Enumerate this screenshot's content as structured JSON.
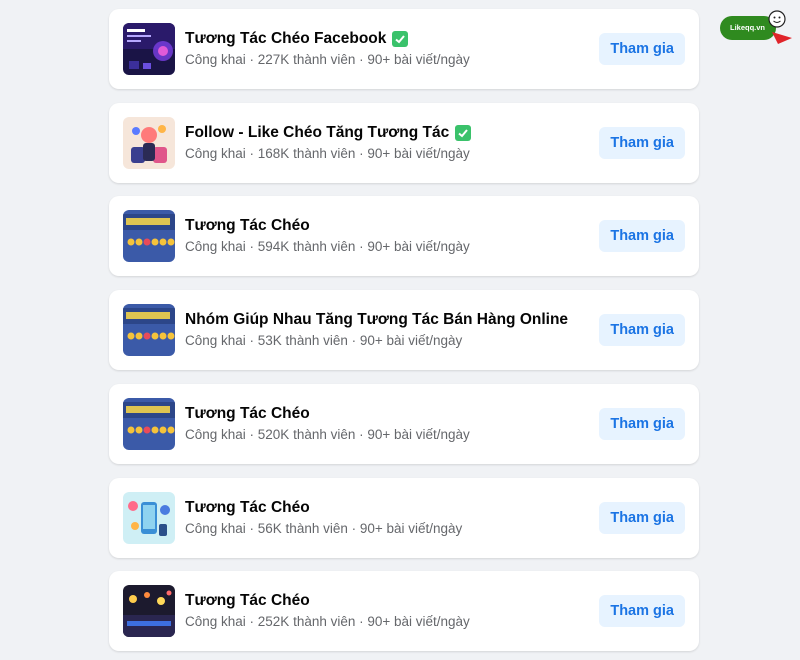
{
  "watermark": {
    "brand": "Likeqq.vn"
  },
  "groups": [
    {
      "name": "Tương Tác Chéo Facebook",
      "verified": true,
      "meta": "Công khai · 227K thành viên · 90+ bài viết/ngày",
      "button": "Tham gia",
      "thumb_icon": "purple-tech-thumbnail"
    },
    {
      "name": "Follow - Like Chéo Tăng Tương Tác",
      "verified": true,
      "meta": "Công khai · 168K thành viên · 90+ bài viết/ngày",
      "button": "Tham gia",
      "thumb_icon": "social-people-thumbnail"
    },
    {
      "name": "Tương Tác Chéo",
      "verified": false,
      "meta": "Công khai · 594K thành viên · 90+ bài viết/ngày",
      "button": "Tham gia",
      "thumb_icon": "reactions-banner-thumbnail"
    },
    {
      "name": "Nhóm Giúp Nhau Tăng Tương Tác Bán Hàng Online",
      "verified": false,
      "meta": "Công khai · 53K thành viên · 90+ bài viết/ngày",
      "button": "Tham gia",
      "thumb_icon": "reactions-banner-thumbnail"
    },
    {
      "name": "Tương Tác Chéo",
      "verified": false,
      "meta": "Công khai · 520K thành viên · 90+ bài viết/ngày",
      "button": "Tham gia",
      "thumb_icon": "reactions-banner-thumbnail"
    },
    {
      "name": "Tương Tác Chéo",
      "verified": false,
      "meta": "Công khai · 56K thành viên · 90+ bài viết/ngày",
      "button": "Tham gia",
      "thumb_icon": "phone-likes-thumbnail"
    },
    {
      "name": "Tương Tác Chéo",
      "verified": false,
      "meta": "Công khai · 252K thành viên · 90+ bài viết/ngày",
      "button": "Tham gia",
      "thumb_icon": "night-lights-thumbnail"
    }
  ],
  "colors": {
    "page_bg": "#f0f2f5",
    "button_bg": "#e7f3ff",
    "button_text": "#1b74e4",
    "verified": "#3ac26b",
    "meta_text": "#65676b"
  }
}
